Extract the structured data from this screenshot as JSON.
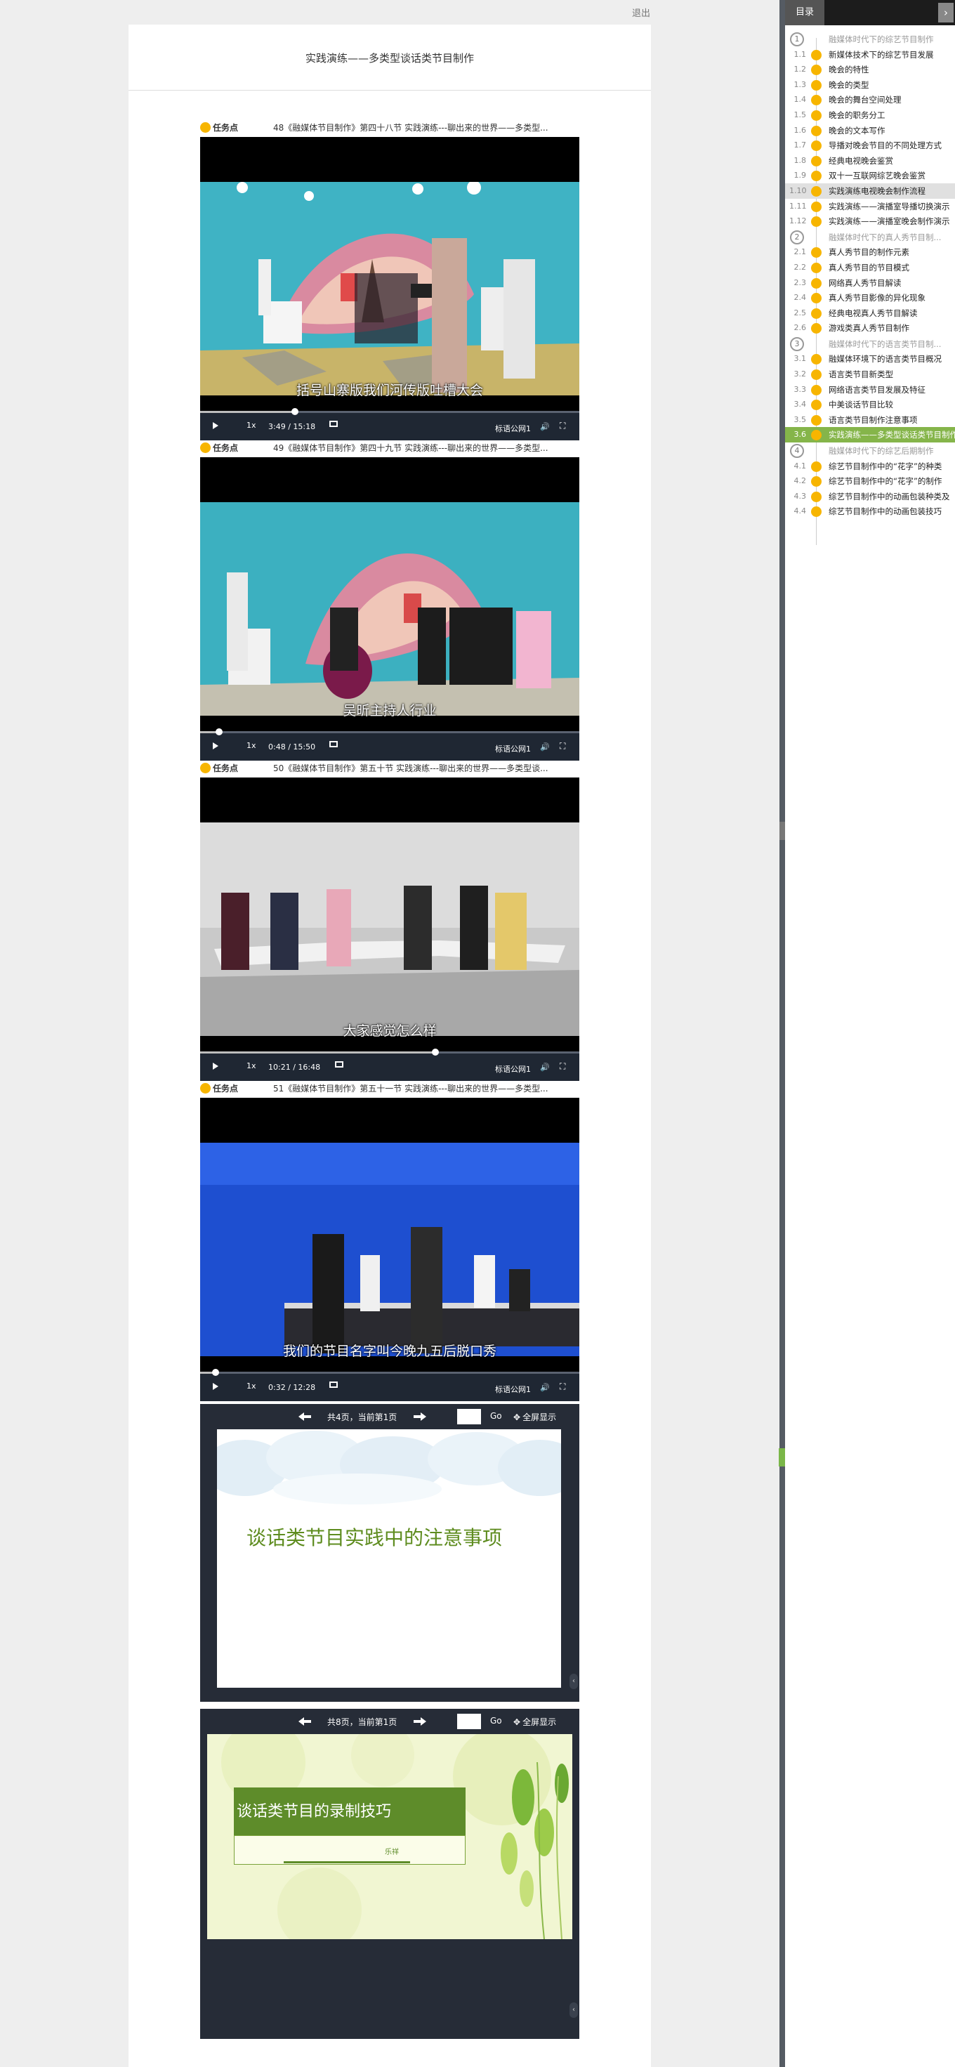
{
  "header": {
    "logout_label": "退出",
    "page_title": "实践演练——多类型谈话类节目制作"
  },
  "tasks": [
    {
      "label": "任务点",
      "text": "48《融媒体节目制作》第四十八节 实践演练---聊出来的世界——多类型...",
      "caption": "括号山寨版我们河传版吐槽大会",
      "time": "3:49 / 15:18",
      "progress": 0.25
    },
    {
      "label": "任务点",
      "text": "49《融媒体节目制作》第四十九节 实践演练---聊出来的世界——多类型...",
      "caption": "吴昕主持人行业",
      "time": "0:48 / 15:50",
      "progress": 0.05
    },
    {
      "label": "任务点",
      "text": "50《融媒体节目制作》第五十节 实践演练---聊出来的世界——多类型谈...",
      "caption": "大家感觉怎么样",
      "time": "10:21 / 16:48",
      "progress": 0.62
    },
    {
      "label": "任务点",
      "text": "51《融媒体节目制作》第五十一节 实践演练---聊出来的世界——多类型...",
      "caption": "我们的节目名字叫今晚九五后脱口秀",
      "time": "0:32 / 12:28",
      "progress": 0.04
    }
  ],
  "player": {
    "speed": "1x",
    "quality": "标语公网1"
  },
  "ppts": [
    {
      "info": "共4页，当前第1页",
      "go": "Go",
      "fullscreen": "全屏显示",
      "slide_title": "谈话类节目实践中的注意事项"
    },
    {
      "info": "共8页，当前第1页",
      "go": "Go",
      "fullscreen": "全屏显示",
      "slide_title": "谈话类节目的录制技巧",
      "slide_author": "乐祥"
    }
  ],
  "sidebar": {
    "tab": "目录",
    "chapters": [
      {
        "number": "1",
        "title": "融媒体时代下的综艺节目制作",
        "sections": [
          {
            "num": "1.1",
            "title": "新媒体技术下的综艺节目发展",
            "badge": "1"
          },
          {
            "num": "1.2",
            "title": "晚会的特性",
            "badge": "2"
          },
          {
            "num": "1.3",
            "title": "晚会的类型",
            "badge": "2"
          },
          {
            "num": "1.4",
            "title": "晚会的舞台空间处理",
            "badge": "2"
          },
          {
            "num": "1.5",
            "title": "晚会的职务分工",
            "badge": "2"
          },
          {
            "num": "1.6",
            "title": "晚会的文本写作",
            "badge": "2"
          },
          {
            "num": "1.7",
            "title": "导播对晚会节目的不同处理方式",
            "badge": "2"
          },
          {
            "num": "1.8",
            "title": "经典电视晚会鉴赏",
            "badge": "1"
          },
          {
            "num": "1.9",
            "title": "双十一互联网综艺晚会鉴赏",
            "badge": "1"
          },
          {
            "num": "1.10",
            "title": "实践演练电视晚会制作流程",
            "badge": "1"
          },
          {
            "num": "1.11",
            "title": "实践演练——演播室导播切换演示",
            "badge": "1"
          },
          {
            "num": "1.12",
            "title": "实践演练——演播室晚会制作演示",
            "badge": "1"
          }
        ]
      },
      {
        "number": "2",
        "title": "融媒体时代下的真人秀节目制...",
        "sections": [
          {
            "num": "2.1",
            "title": "真人秀节目的制作元素",
            "badge": "2"
          },
          {
            "num": "2.2",
            "title": "真人秀节目的节目模式",
            "badge": "2"
          },
          {
            "num": "2.3",
            "title": "网络真人秀节目解读",
            "badge": "1"
          },
          {
            "num": "2.4",
            "title": "真人秀节目影像的异化现象",
            "badge": "2"
          },
          {
            "num": "2.5",
            "title": "经典电视真人秀节目解读",
            "badge": "1"
          },
          {
            "num": "2.6",
            "title": "游戏类真人秀节目制作",
            "badge": "1"
          }
        ]
      },
      {
        "number": "3",
        "title": "融媒体时代下的语言类节目制...",
        "sections": [
          {
            "num": "3.1",
            "title": "融媒体环境下的语言类节目概况",
            "badge": "1"
          },
          {
            "num": "3.2",
            "title": "语言类节目新类型",
            "badge": "1"
          },
          {
            "num": "3.3",
            "title": "网络语言类节目发展及特征",
            "badge": "1"
          },
          {
            "num": "3.4",
            "title": "中美谈话节目比较",
            "badge": "1"
          },
          {
            "num": "3.5",
            "title": "语言类节目制作注意事项",
            "badge": "2"
          },
          {
            "num": "3.6",
            "title": "实践演练——多类型谈话类节目制作",
            "badge": "4"
          }
        ]
      },
      {
        "number": "4",
        "title": "融媒体时代下的综艺后期制作",
        "sections": [
          {
            "num": "4.1",
            "title": "综艺节目制作中的“花字”的种类",
            "badge": "1"
          },
          {
            "num": "4.2",
            "title": "综艺节目制作中的“花字”的制作",
            "badge": "1"
          },
          {
            "num": "4.3",
            "title": "综艺节目制作中的动画包装种类及",
            "badge": "1"
          },
          {
            "num": "4.4",
            "title": "综艺节目制作中的动画包装技巧",
            "badge": "1"
          }
        ]
      }
    ]
  }
}
